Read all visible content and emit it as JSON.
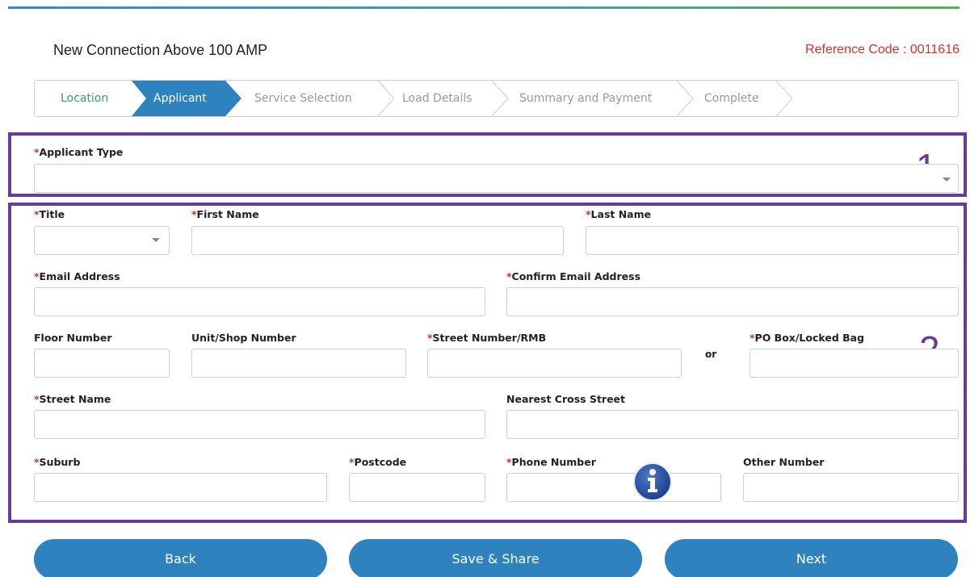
{
  "header": {
    "title": "New Connection Above 100 AMP",
    "reference": "Reference Code : 0011616"
  },
  "stepper": {
    "steps": [
      {
        "label": "Location",
        "state": "done"
      },
      {
        "label": "Applicant",
        "state": "active"
      },
      {
        "label": "Service Selection",
        "state": "pending"
      },
      {
        "label": "Load Details",
        "state": "pending"
      },
      {
        "label": "Summary and Payment",
        "state": "pending"
      },
      {
        "label": "Complete",
        "state": "pending"
      }
    ]
  },
  "annotations": {
    "box1": "1",
    "box2": "2"
  },
  "required_mark": "*",
  "form": {
    "applicant_type": {
      "label": "Applicant Type",
      "value": ""
    },
    "title": {
      "label": "Title",
      "value": ""
    },
    "first_name": {
      "label": "First Name",
      "value": ""
    },
    "last_name": {
      "label": "Last Name",
      "value": ""
    },
    "email": {
      "label": "Email Address",
      "value": ""
    },
    "confirm_email": {
      "label": "Confirm Email Address",
      "value": ""
    },
    "floor_number": {
      "label": "Floor Number",
      "value": ""
    },
    "unit_shop": {
      "label": "Unit/Shop Number",
      "value": ""
    },
    "street_number": {
      "label": "Street Number/RMB",
      "value": ""
    },
    "or_text": "or",
    "po_box": {
      "label": "PO Box/Locked Bag",
      "value": ""
    },
    "street_name": {
      "label": "Street Name",
      "value": ""
    },
    "cross_street": {
      "label": "Nearest Cross Street",
      "value": ""
    },
    "suburb": {
      "label": "Suburb",
      "value": ""
    },
    "postcode": {
      "label": "Postcode",
      "value": ""
    },
    "phone": {
      "label": "Phone Number",
      "value": ""
    },
    "other_number": {
      "label": "Other Number",
      "value": ""
    }
  },
  "buttons": {
    "back": "Back",
    "save_share": "Save & Share",
    "next": "Next"
  },
  "colors": {
    "accent": "#2e82bd",
    "done_step": "#3aa35a",
    "required": "#c0392b",
    "reference": "#d0342c",
    "annotation": "#6a3a9a"
  },
  "icons": {
    "info": "info-icon"
  }
}
